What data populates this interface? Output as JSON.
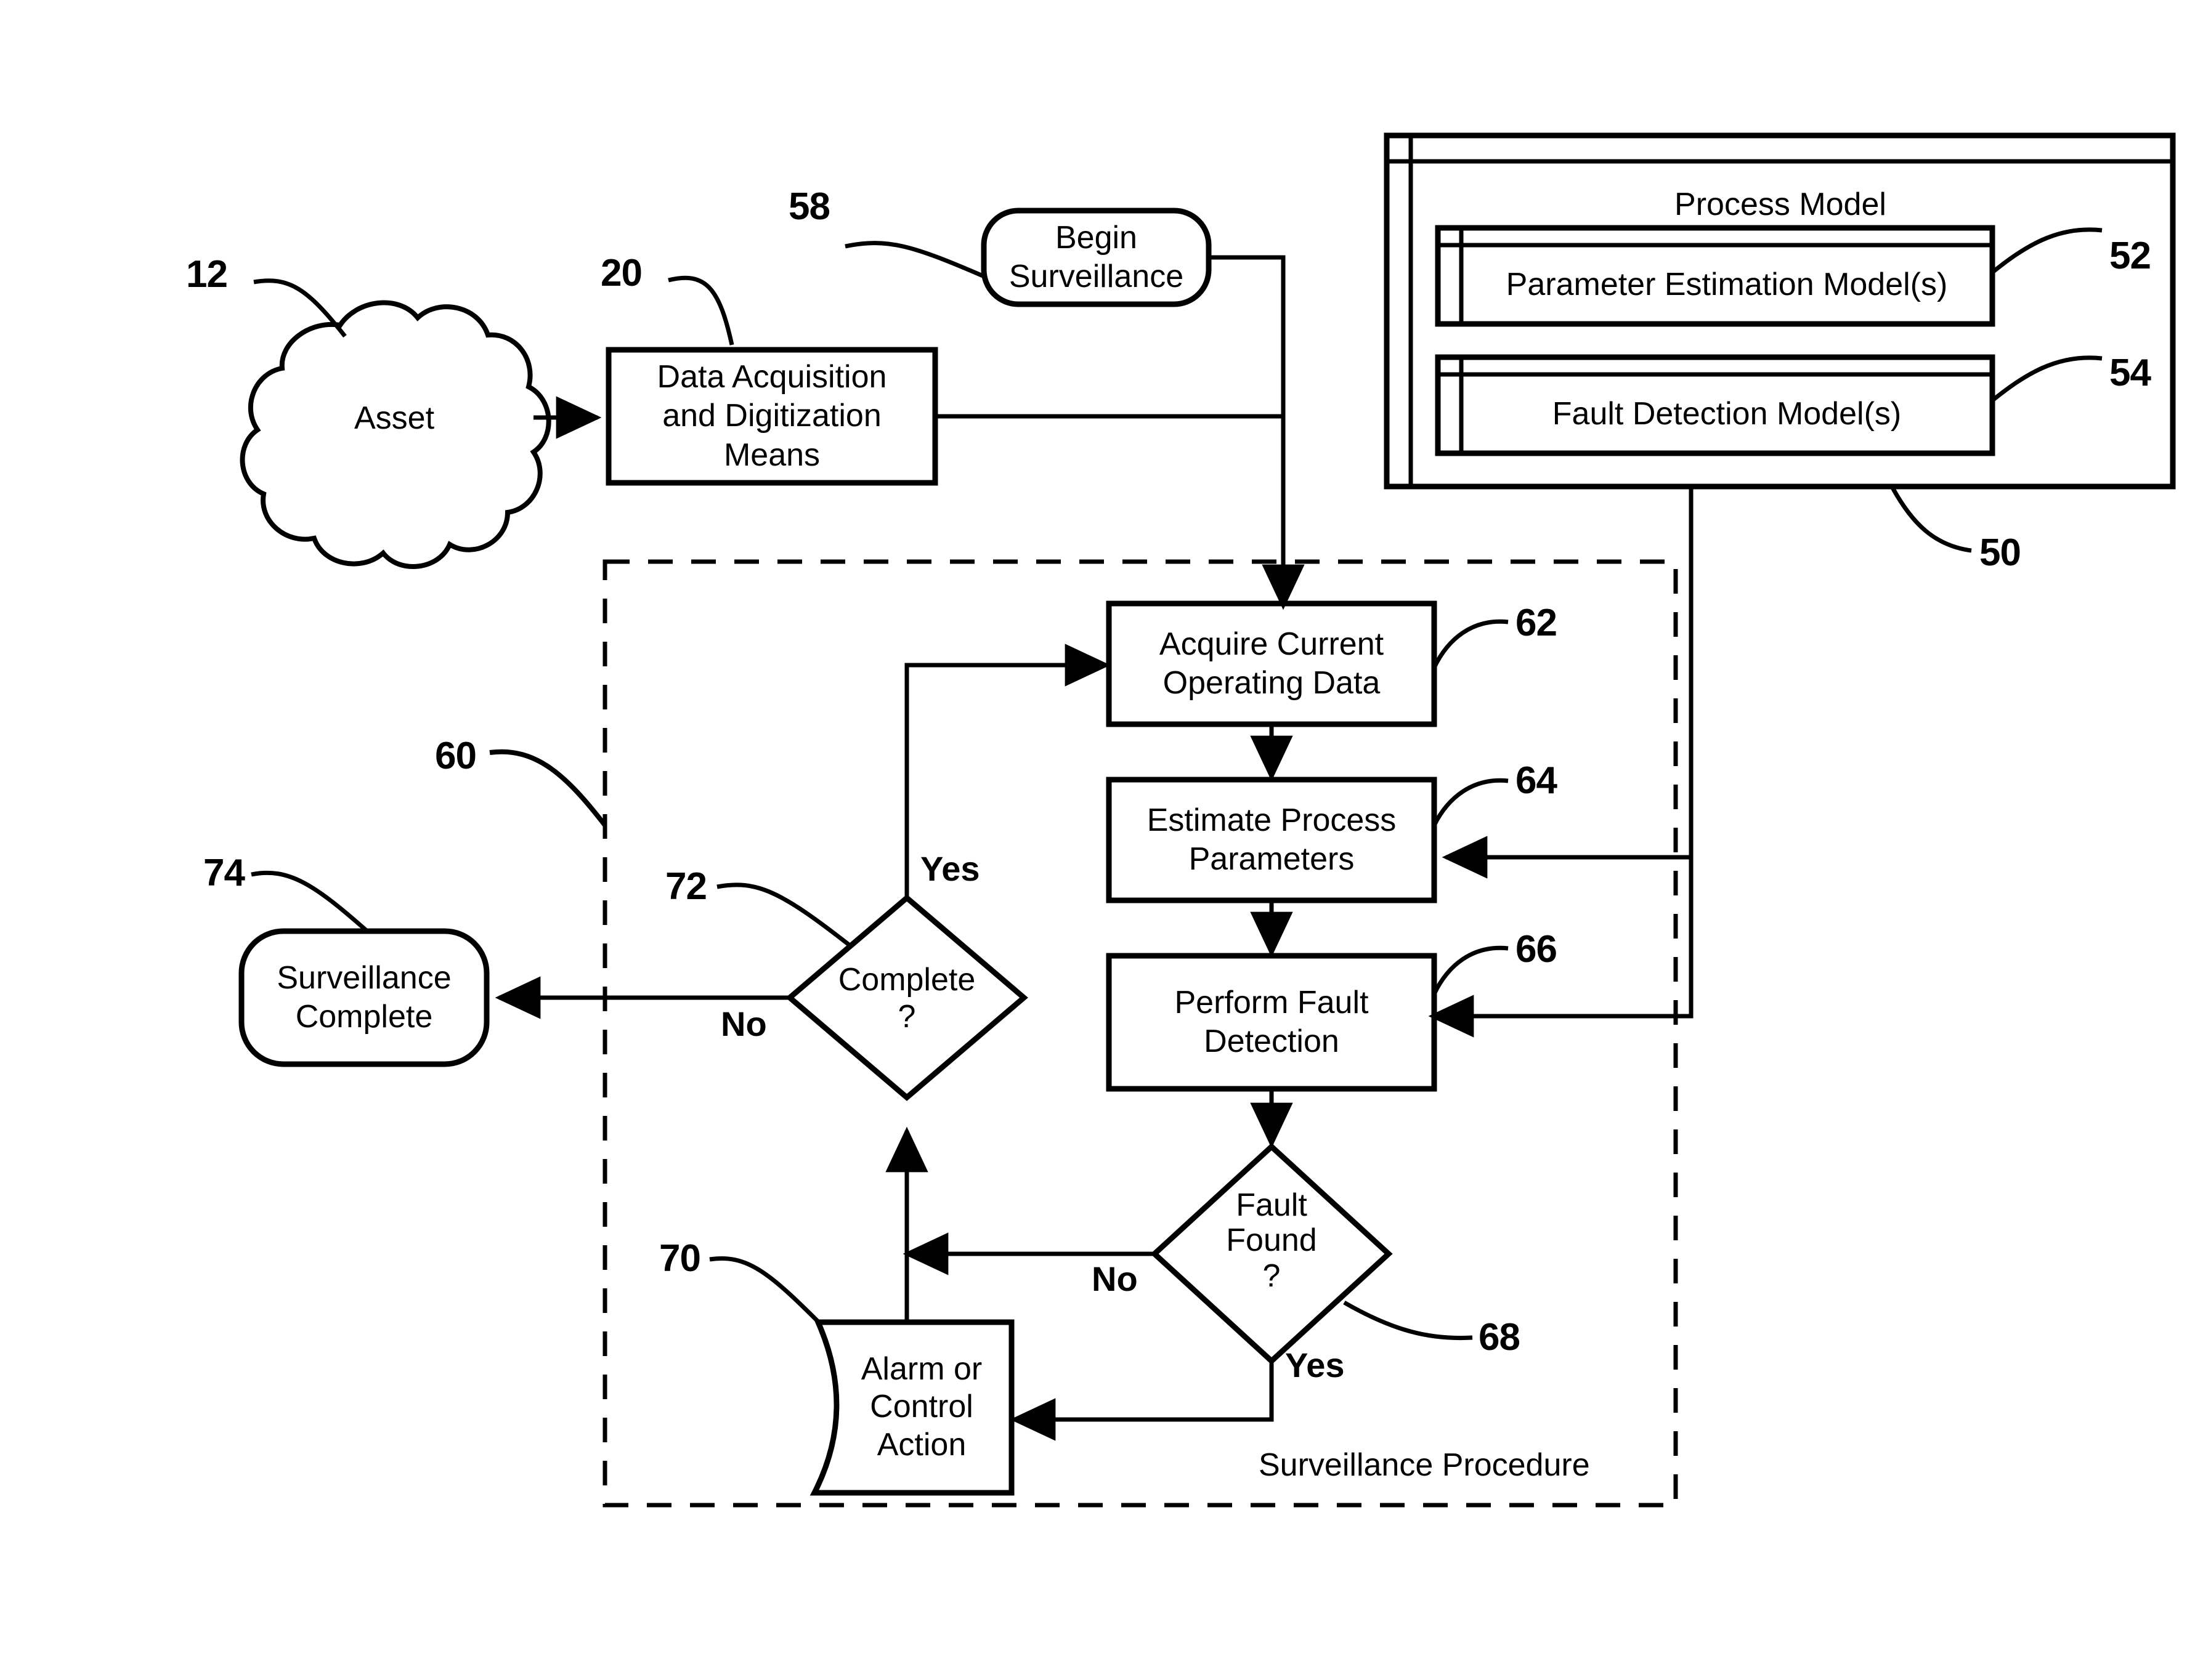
{
  "figure": {
    "title": "Asset surveillance procedure flow diagram",
    "line_color": "#000000",
    "background": "#ffffff"
  },
  "nodes": {
    "asset": {
      "label": "Asset",
      "ref": "12",
      "shape": "cloud"
    },
    "data_acquisition": {
      "label": "Data Acquisition\nand Digitization\nMeans",
      "ref": "20",
      "shape": "rectangle"
    },
    "begin_surveillance": {
      "label": "Begin\nSurveillance",
      "ref": "58",
      "shape": "terminator"
    },
    "process_model": {
      "label": "Process Model",
      "ref": "50",
      "shape": "stacked-container"
    },
    "parameter_estimation_model": {
      "label": "Parameter Estimation Model(s)",
      "ref": "52",
      "shape": "stacked-rectangle"
    },
    "fault_detection_model": {
      "label": "Fault Detection Model(s)",
      "ref": "54",
      "shape": "stacked-rectangle"
    },
    "acquire_data": {
      "label": "Acquire Current\nOperating Data",
      "ref": "62",
      "shape": "rectangle"
    },
    "estimate_parameters": {
      "label": "Estimate Process\nParameters",
      "ref": "64",
      "shape": "rectangle"
    },
    "perform_fault_detection": {
      "label": "Perform Fault\nDetection",
      "ref": "66",
      "shape": "rectangle"
    },
    "fault_found": {
      "label": "Fault\nFound\n?",
      "ref": "68",
      "shape": "diamond"
    },
    "alarm_or_control": {
      "label": "Alarm or\nControl\nAction",
      "ref": "70",
      "shape": "manual-operation"
    },
    "complete": {
      "label": "Complete\n?",
      "ref": "72",
      "shape": "diamond"
    },
    "surveillance_complete": {
      "label": "Surveillance\nComplete",
      "ref": "74",
      "shape": "terminator"
    }
  },
  "groups": {
    "surveillance_procedure": {
      "label": "Surveillance Procedure",
      "ref": "60",
      "border": "dashed"
    }
  },
  "edge_labels": {
    "complete_yes": "Yes",
    "complete_no": "No",
    "fault_no": "No",
    "fault_yes": "Yes"
  },
  "reference_numerals": [
    "12",
    "20",
    "58",
    "50",
    "52",
    "54",
    "60",
    "62",
    "64",
    "66",
    "68",
    "70",
    "72",
    "74"
  ]
}
